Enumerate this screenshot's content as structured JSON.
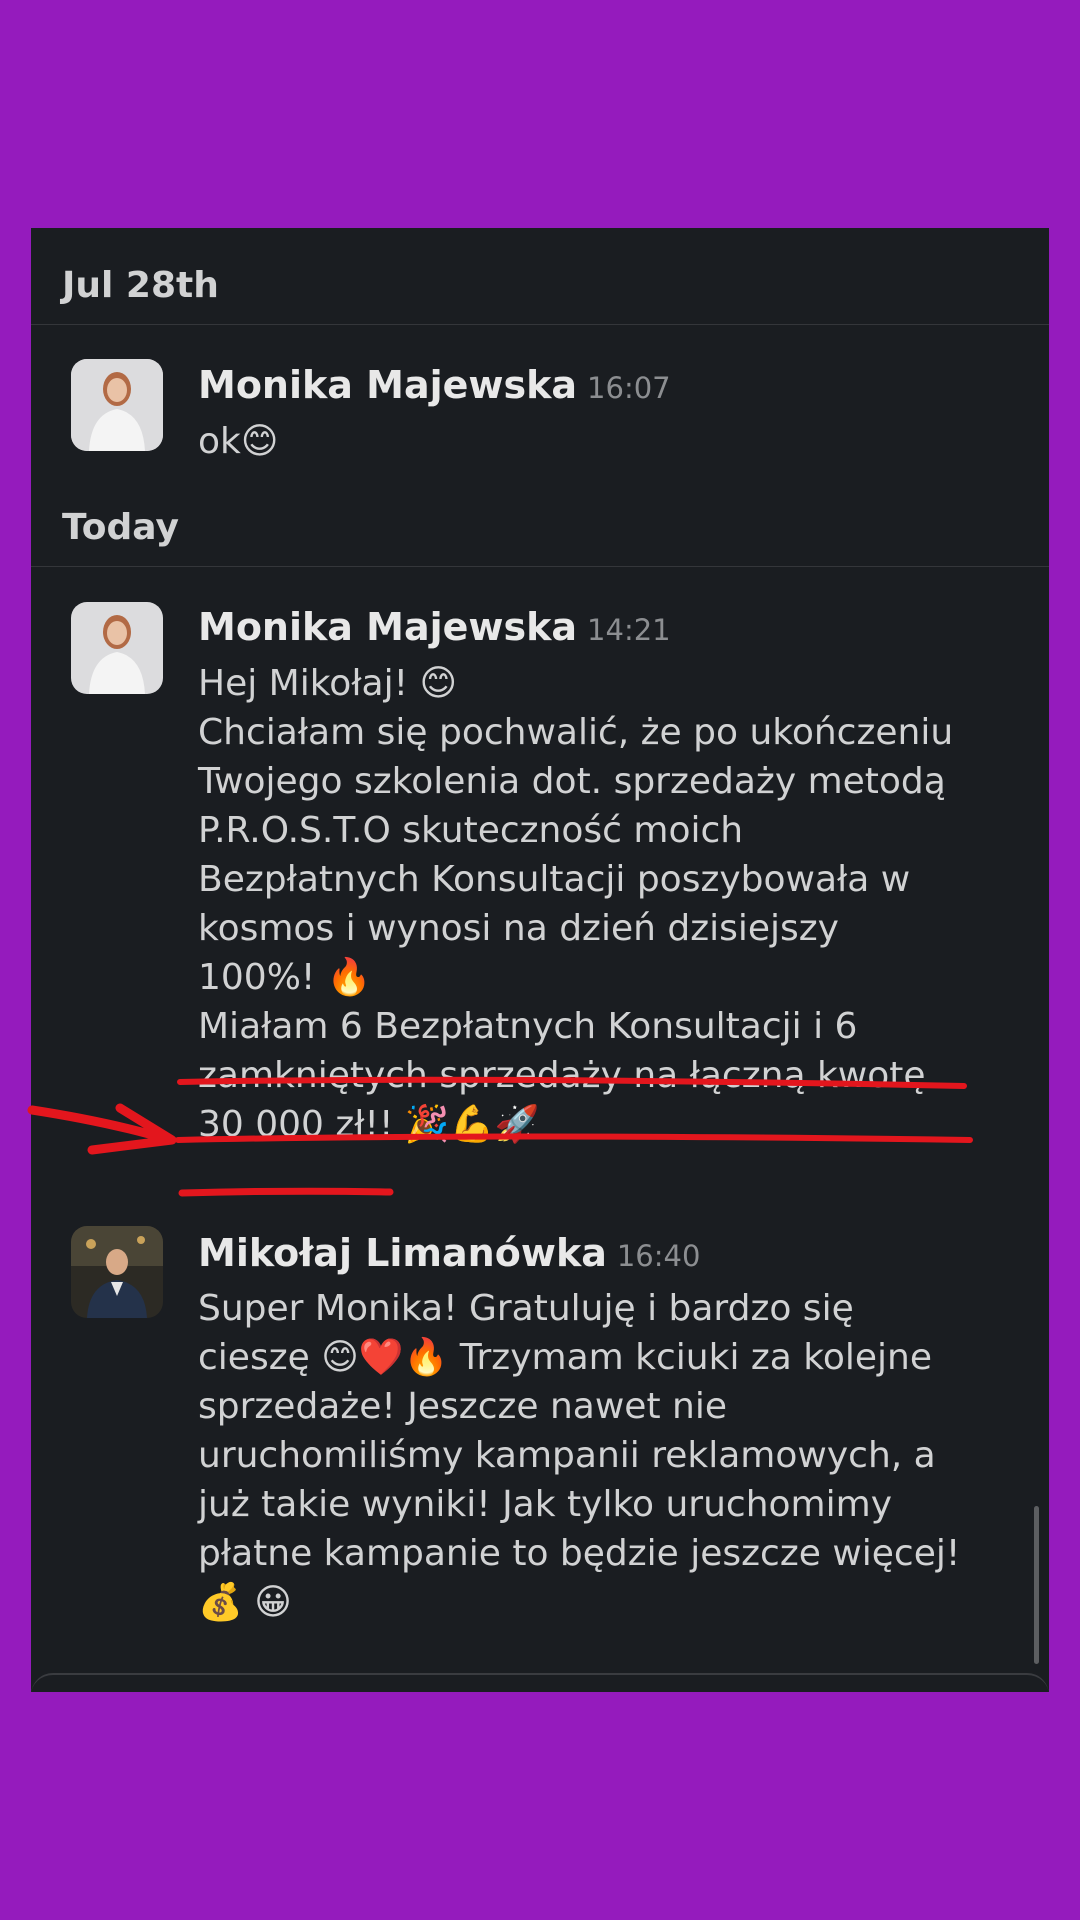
{
  "sections": [
    {
      "date_label": "Jul 28th"
    },
    {
      "date_label": "Today"
    }
  ],
  "messages": [
    {
      "sender": "Monika Majewska",
      "time": "16:07",
      "text": "ok😊"
    },
    {
      "sender": "Monika Majewska",
      "time": "14:21",
      "text": "Hej Mikołaj! 😊\nChciałam się pochwalić, że po ukończeniu\nTwojego szkolenia dot. sprzedaży metodą\nP.R.O.S.T.O skuteczność moich\nBezpłatnych Konsultacji poszybowała w\nkosmos i wynosi na dzień dzisiejszy\n100%! 🔥\nMiałam 6 Bezpłatnych Konsultacji i 6\nzamkniętych sprzedaży na łączną kwotę\n30 000 zł!! 🎉💪🚀"
    },
    {
      "sender": "Mikołaj Limanówka",
      "time": "16:40",
      "text": "Super Monika! Gratuluję i bardzo się\ncieszę 😊❤️🔥 Trzymam kciuki za kolejne\nsprzedaże! Jeszcze nawet nie\nuruchomiliśmy kampanii reklamowych, a\njuż takie wyniki! Jak tylko uruchomimy\npłatne kampanie to będzie jeszcze więcej!\n💰 😀"
    }
  ],
  "colors": {
    "page_background": "#951bbd",
    "chat_background": "#1a1d21",
    "annotation": "#e3161d"
  },
  "icons": [
    "avatar-monika",
    "avatar-mikolaj"
  ]
}
